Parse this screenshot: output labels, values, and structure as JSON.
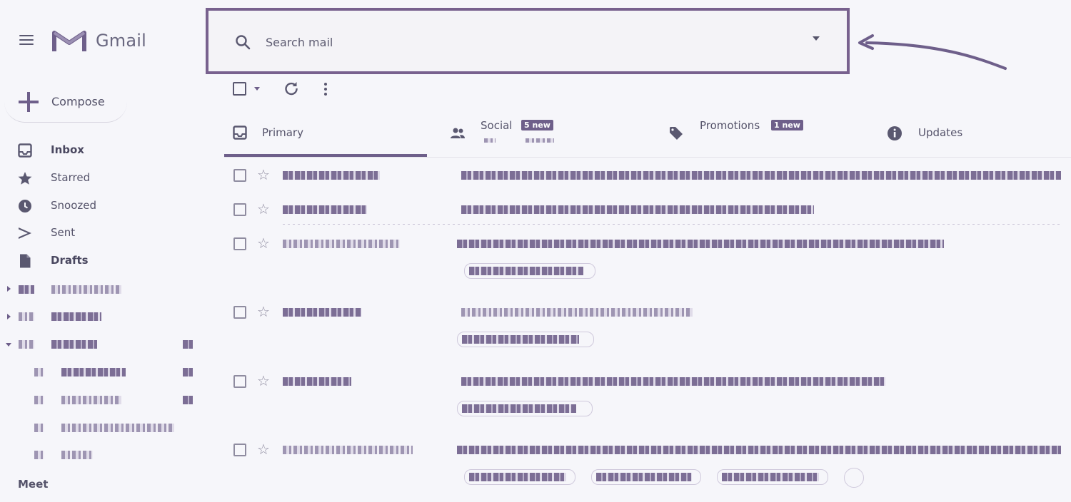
{
  "app": {
    "logo_text": "Gmail"
  },
  "search": {
    "placeholder": "Search mail"
  },
  "compose": {
    "label": "Compose"
  },
  "sidebar": {
    "items": [
      {
        "label": "Inbox",
        "icon": "inbox-icon",
        "bold": true
      },
      {
        "label": "Starred",
        "icon": "star-icon",
        "bold": false
      },
      {
        "label": "Snoozed",
        "icon": "clock-icon",
        "bold": false
      },
      {
        "label": "Sent",
        "icon": "send-icon",
        "bold": false
      },
      {
        "label": "Drafts",
        "icon": "draft-icon",
        "bold": true
      }
    ],
    "meet_label": "Meet"
  },
  "tabs": [
    {
      "label": "Primary",
      "icon": "inbox-icon",
      "active": true
    },
    {
      "label": "Social",
      "icon": "people-icon",
      "badge": "5 new"
    },
    {
      "label": "Promotions",
      "icon": "tag-icon",
      "badge": "1 new"
    },
    {
      "label": "Updates",
      "icon": "info-icon"
    }
  ],
  "colors": {
    "accent": "#6e5f8a",
    "highlight_border": "#78618e",
    "background": "#f6f6fa"
  }
}
